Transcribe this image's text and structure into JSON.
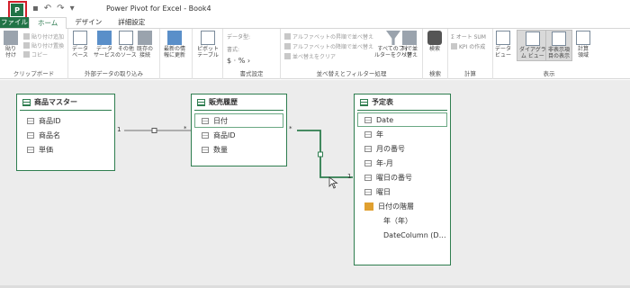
{
  "window": {
    "app_icon_label": "P",
    "title": "Power Pivot for Excel - Book4",
    "qat": {
      "save": "▪",
      "undo": "↶",
      "redo": "↷",
      "more": "▾"
    }
  },
  "tabs": [
    {
      "label": "ファイル"
    },
    {
      "label": "ホーム"
    },
    {
      "label": "デザイン"
    },
    {
      "label": "詳細設定"
    }
  ],
  "ribbon": {
    "clipboard": {
      "label": "クリップボード",
      "paste": "貼り\n付け",
      "paste_append": "貼り付け追加",
      "paste_replace": "貼り付け置換",
      "copy": "コピー"
    },
    "external": {
      "label": "外部データの取り込み",
      "database": "データ\nベース",
      "data_service": "データ\nサービス",
      "other_sources": "その他\nのソース",
      "existing": "既存の\n接続"
    },
    "refresh": {
      "label": "最新の情\n報に更新"
    },
    "pivot": {
      "label": "ピボット\nテーブル"
    },
    "format": {
      "label": "書式設定",
      "datatype": "データ型:",
      "format": "書式:",
      "symbols": "$ · % ›"
    },
    "sortfilter": {
      "label": "並べ替えとフィルター処理",
      "sort_asc": "アルファベットの昇順で並べ替え",
      "sort_desc": "アルファベットの降順で並べ替え",
      "clear_sort": "並べ替えをクリア",
      "clear_filter": "すべてのフィ\nルターをクリア",
      "sort_by_col": "列で並\nべ替え"
    },
    "find": {
      "label": "検索",
      "button": "検索"
    },
    "calc": {
      "label": "計算",
      "autosum": "Σ オート SUM",
      "kpi": "KPI の作成"
    },
    "view": {
      "label": "表示",
      "data_view": "データ\nビュー",
      "diagram_view": "ダイアグラ\nム ビュー",
      "show_hidden": "非表示項\n目の表示",
      "calc_area": "計算\n領域"
    }
  },
  "diagram": {
    "tables": [
      {
        "name": "商品マスター",
        "columns": [
          "商品ID",
          "商品名",
          "単価"
        ]
      },
      {
        "name": "販売履歴",
        "columns": [
          "日付",
          "商品ID",
          "数量"
        ],
        "selected_column": "日付"
      },
      {
        "name": "予定表",
        "columns": [
          "Date",
          "年",
          "月の番号",
          "年-月",
          "曜日の番号",
          "曜日"
        ],
        "selected_column": "Date",
        "hierarchy": {
          "name": "日付の階層",
          "levels": [
            "年（年）",
            "DateColumn (D…"
          ]
        }
      }
    ],
    "relationships": [
      {
        "from_label": "1",
        "to_label": "*"
      },
      {
        "from_label": "*",
        "to_label": "1"
      }
    ]
  }
}
